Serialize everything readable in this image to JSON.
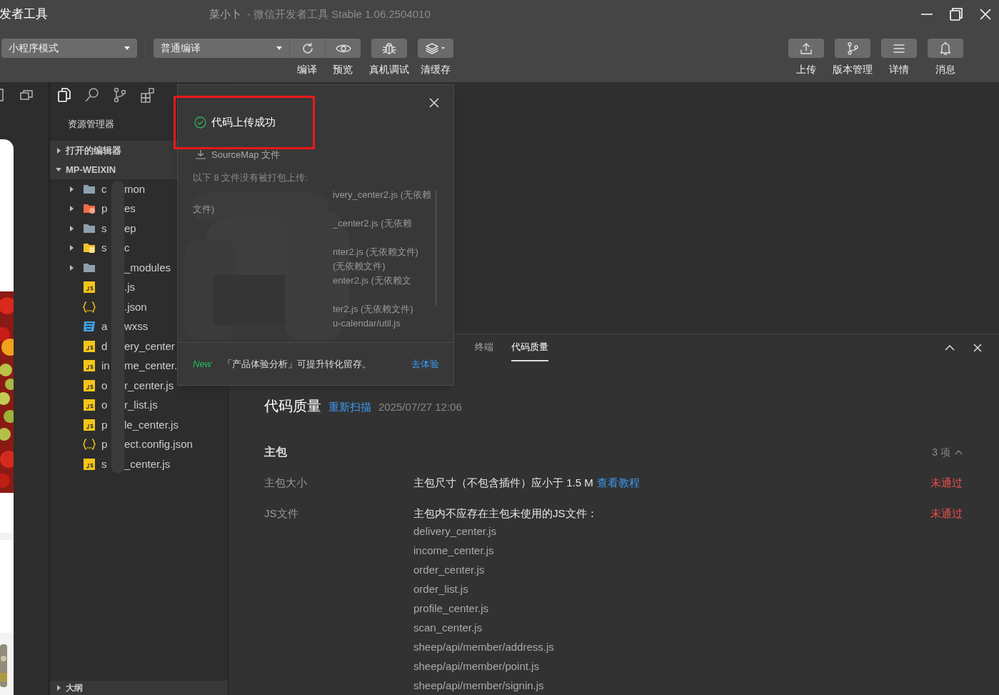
{
  "window": {
    "title_left": "发者工具",
    "app_name": "菜小卜",
    "title": "- 微信开发者工具 Stable 1.06.2504010"
  },
  "toolbar": {
    "mode_select": "小程序模式",
    "compile_select": "普通编译",
    "left_buttons": [
      {
        "label": "编译",
        "joined": true
      },
      {
        "label": "预览",
        "joined": true
      },
      {
        "label": "真机调试",
        "joined": false
      },
      {
        "label": "清缓存",
        "joined": false
      }
    ],
    "right_buttons": [
      {
        "label": "上传"
      },
      {
        "label": "版本管理"
      },
      {
        "label": "详情"
      },
      {
        "label": "消息"
      }
    ]
  },
  "explorer": {
    "title": "资源管理器",
    "sections": [
      {
        "label": "打开的编辑器",
        "expanded": false
      },
      {
        "label": "MP-WEIXIN",
        "expanded": true,
        "children": [
          {
            "kind": "folder",
            "prefix": "c",
            "suffix": "mon",
            "expanded": false
          },
          {
            "kind": "folder-pages",
            "prefix": "p",
            "suffix": "es",
            "expanded": false
          },
          {
            "kind": "folder",
            "prefix": "s",
            "suffix": "ep",
            "expanded": false
          },
          {
            "kind": "folder-static",
            "prefix": "s",
            "suffix": "c",
            "expanded": false
          },
          {
            "kind": "folder",
            "suffix": "_modules",
            "expanded": false
          },
          {
            "kind": "js",
            "suffix": ".js"
          },
          {
            "kind": "json",
            "suffix": ".json"
          },
          {
            "kind": "css",
            "prefix": "a",
            "suffix": "wxss"
          },
          {
            "kind": "js",
            "prefix": "d",
            "suffix": "ery_center"
          },
          {
            "kind": "js",
            "prefix": "in",
            "suffix": "me_center."
          },
          {
            "kind": "js",
            "prefix": "o",
            "suffix": "r_center.js"
          },
          {
            "kind": "js",
            "prefix": "o",
            "suffix": "r_list.js"
          },
          {
            "kind": "js",
            "prefix": "p",
            "suffix": "le_center.js"
          },
          {
            "kind": "json",
            "prefix": "p",
            "suffix": "ect.config.json"
          },
          {
            "kind": "js",
            "prefix": "s",
            "suffix": "_center.js"
          }
        ]
      }
    ],
    "outline": {
      "label": "大纲",
      "expanded": false
    }
  },
  "popup": {
    "title": "代码上传成功",
    "sourcemap": "SourceMap 文件",
    "note": "以下 8 文件没有被打包上传:",
    "groups": [
      [
        {
          "kind": "tail",
          "text": "ivery_center2.js (无依赖"
        },
        {
          "kind": "head",
          "text": "文件)"
        },
        {
          "kind": "tail",
          "text": "_center2.js (无依赖"
        }
      ],
      [
        {
          "kind": "tail",
          "text": "nter2.js (无依赖文件)"
        },
        {
          "kind": "tail",
          "text": "(无依赖文件)"
        },
        {
          "kind": "tail",
          "text": "enter2.js (无依赖文"
        }
      ],
      [
        {
          "kind": "tail",
          "text": "ter2.js (无依赖文件)"
        },
        {
          "kind": "tail",
          "text": "u-calendar/util.js"
        }
      ]
    ],
    "promo": {
      "badge": "New",
      "text": "「产品体验分析」可提升转化留存。",
      "link": "去体验"
    }
  },
  "panel": {
    "tabs": [
      {
        "label": "终端",
        "selected": false
      },
      {
        "label": "代码质量",
        "selected": true
      }
    ],
    "title": "代码质量",
    "rescan": "重新扫描",
    "time": "2025/07/27 12:06",
    "group": {
      "title": "主包",
      "count": "3 项",
      "expanded": true,
      "rows": [
        {
          "label": "主包大小",
          "description": "主包尺寸（不包含插件）应小于 1.5 M",
          "link": "查看教程",
          "passed": false,
          "status": "未通过"
        },
        {
          "label": "JS文件",
          "description": "主包内不应存在主包未使用的JS文件：",
          "passed": false,
          "status": "未通过",
          "files": [
            "delivery_center.js",
            "income_center.js",
            "order_center.js",
            "order_list.js",
            "profile_center.js",
            "scan_center.js",
            "sheep/api/member/address.js",
            "sheep/api/member/point.js",
            "sheep/api/member/signin.js"
          ]
        }
      ]
    }
  }
}
